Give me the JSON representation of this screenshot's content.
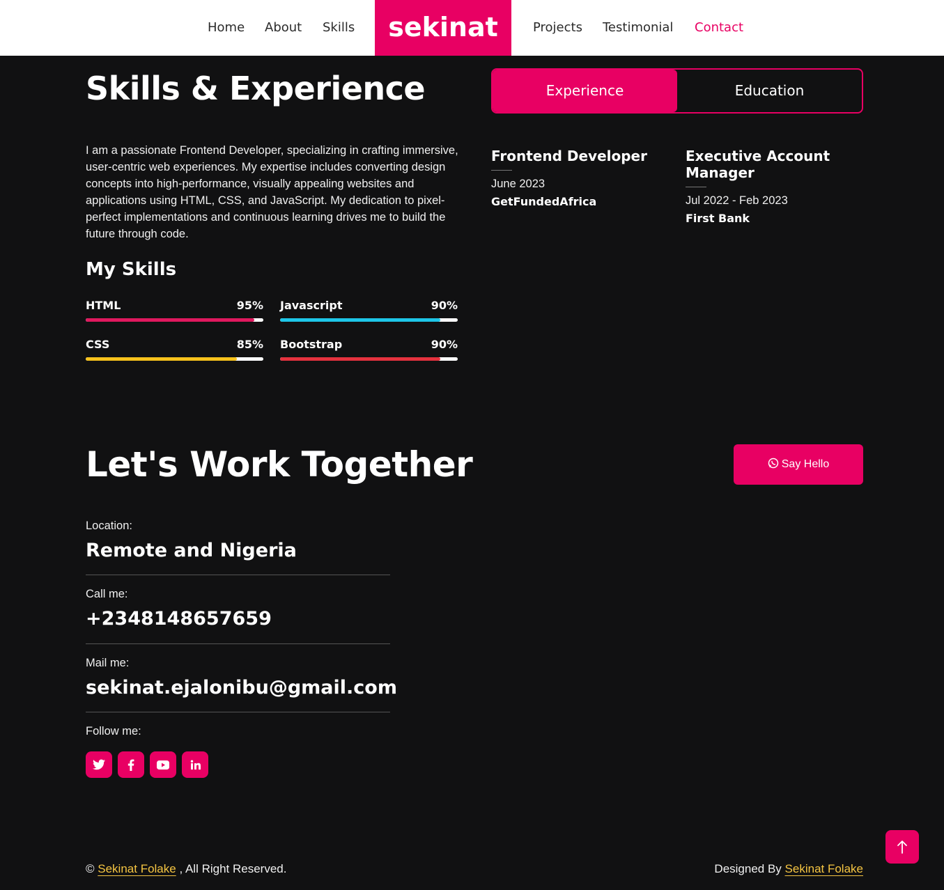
{
  "nav": {
    "links_left": [
      "Home",
      "About",
      "Skills"
    ],
    "brand": "sekinat",
    "links_right": [
      "Projects",
      "Testimonial",
      "Contact"
    ],
    "active": "Contact"
  },
  "skills_section": {
    "heading": "Skills & Experience",
    "tabs": [
      "Experience",
      "Education"
    ],
    "active_tab": "Experience",
    "intro": "I am a passionate Frontend Developer, specializing in crafting immersive, user-centric web experiences. My expertise includes converting design concepts into high-performance, visually appealing websites and applications using HTML, CSS, and JavaScript. My dedication to pixel-perfect implementations and continuous learning drives me to build the future through code.",
    "my_skills_heading": "My Skills",
    "skills": [
      {
        "name": "HTML",
        "percent_label": "95%",
        "value": 95,
        "color": "#e0195e"
      },
      {
        "name": "Javascript",
        "percent_label": "90%",
        "value": 90,
        "color": "#1ec6e8"
      },
      {
        "name": "CSS",
        "percent_label": "85%",
        "value": 85,
        "color": "#f6c21c"
      },
      {
        "name": "Bootstrap",
        "percent_label": "90%",
        "value": 90,
        "color": "#e5323e"
      }
    ],
    "experience": [
      {
        "title": "Frontend Developer",
        "date": "June 2023",
        "org": "GetFundedAfrica"
      },
      {
        "title": "Executive Account Manager",
        "date": "Jul 2022 - Feb 2023",
        "org": "First Bank"
      }
    ]
  },
  "contact_section": {
    "heading": "Let's Work Together",
    "say_hello": "Say Hello",
    "location_label": "Location:",
    "location_value": "Remote and Nigeria",
    "call_label": "Call me:",
    "call_value": "+2348148657659",
    "mail_label": "Mail me:",
    "mail_value": "sekinat.ejalonibu@gmail.com",
    "follow_label": "Follow me:",
    "socials": [
      "twitter-icon",
      "facebook-icon",
      "youtube-icon",
      "linkedin-icon"
    ]
  },
  "footer": {
    "copyright_symbol": "©",
    "left_name": "Sekinat Folake",
    "left_suffix": ", All Right Reserved.",
    "right_prefix": "Designed By",
    "right_name": "Sekinat Folake"
  },
  "colors": {
    "accent": "#e80063",
    "background": "#111112",
    "link_yellow": "#f5c542"
  }
}
